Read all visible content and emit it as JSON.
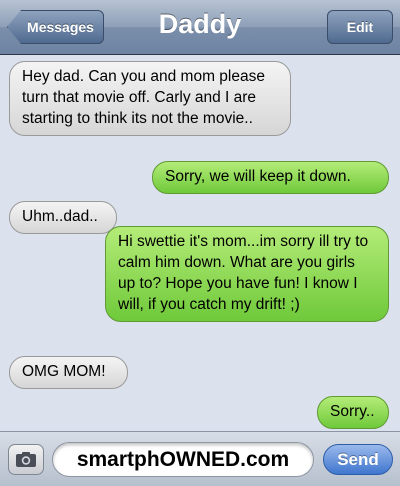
{
  "navbar": {
    "back_label": "Messages",
    "title": "Daddy",
    "edit_label": "Edit"
  },
  "messages": [
    {
      "direction": "incoming",
      "text": "Hey dad. Can you and mom please turn that movie off. Carly and I are starting to think its not the movie.."
    },
    {
      "direction": "outgoing",
      "text": "Sorry, we will keep it down."
    },
    {
      "direction": "incoming",
      "text": "Uhm..dad.."
    },
    {
      "direction": "outgoing",
      "text": "Hi swettie it's mom...im sorry ill try to calm him down. What are you girls up to? Hope you have fun! I know I will, if you catch my drift! ;)"
    },
    {
      "direction": "incoming",
      "text": "OMG MOM!"
    },
    {
      "direction": "outgoing",
      "text": "Sorry.."
    }
  ],
  "composer": {
    "camera_icon": "camera-icon",
    "field_text": "smartphOWNED.com",
    "send_label": "Send"
  },
  "colors": {
    "outgoing_bubble": "#7ed348",
    "incoming_bubble": "#e6e6e6",
    "send_button": "#4a7fd4",
    "background": "#dbe2ed"
  }
}
